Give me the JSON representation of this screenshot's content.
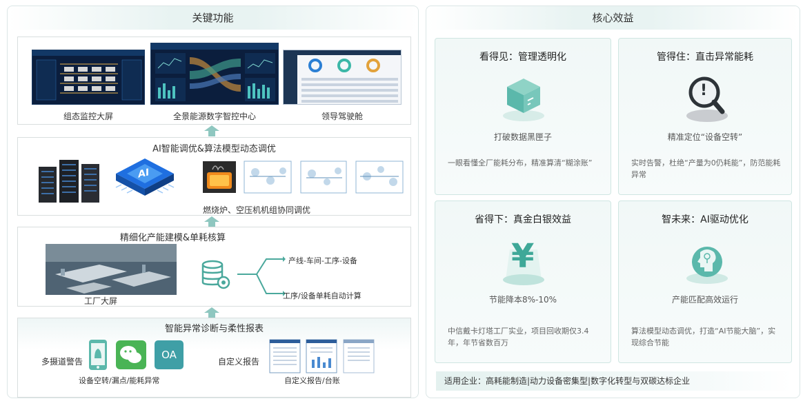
{
  "left": {
    "title": "关键功能",
    "monitor": {
      "screens": [
        {
          "caption": "组态监控大屏"
        },
        {
          "caption": "全景能源数字智控中心"
        },
        {
          "caption": "领导驾驶舱"
        }
      ]
    },
    "ai": {
      "title": "AI智能调优&算法模型动态调优",
      "chip_label": "AI",
      "caption": "燃烧炉、空压机机组协同调优"
    },
    "modeling": {
      "title": "精细化产能建模&单耗核算",
      "factory_caption": "工厂大屏",
      "branch_top": "产线-车间-工序-设备",
      "branch_bottom": "工序/设备单耗自动计算"
    },
    "diagnosis": {
      "title": "智能异常诊断与柔性报表",
      "alert_label": "多摄道警告",
      "alert_caption": "设备空转/漏点/能耗异常",
      "oa_label": "OA",
      "report_label": "自定义报告",
      "report_caption": "自定义报告/台账"
    }
  },
  "right": {
    "title": "核心效益",
    "cards": [
      {
        "title": "看得见：管理透明化",
        "subtitle": "打破数据黑匣子",
        "desc": "一眼看懂全厂能耗分布，精准算清“糊涂账”",
        "icon": "box-icon"
      },
      {
        "title": "管得住：直击异常能耗",
        "subtitle": "精准定位“设备空转”",
        "desc": "实时告警，杜绝“产量为0仍耗能”，防范能耗异常",
        "icon": "alert-magnifier-icon"
      },
      {
        "title": "省得下：真金白银效益",
        "subtitle": "节能降本8%-10%",
        "desc": "中信戴卡灯塔工厂实业，项目回收期仅3.4年，年节省数百万",
        "icon": "yen-icon"
      },
      {
        "title": "智未来：AI驱动优化",
        "subtitle": "产能匹配高效运行",
        "desc": "算法模型动态调优，打造“AI节能大脑”，实现综合节能",
        "icon": "ai-brain-icon"
      }
    ],
    "icon_glyphs": {
      "yen": "¥",
      "alert": "!"
    },
    "footer": "适用企业：高耗能制造|动力设备密集型|数字化转型与双碳达标企业"
  },
  "colors": {
    "accent": "#5bb8ab",
    "accent_light": "#8fc7c0",
    "dark_screen": "#0b1e3d"
  }
}
